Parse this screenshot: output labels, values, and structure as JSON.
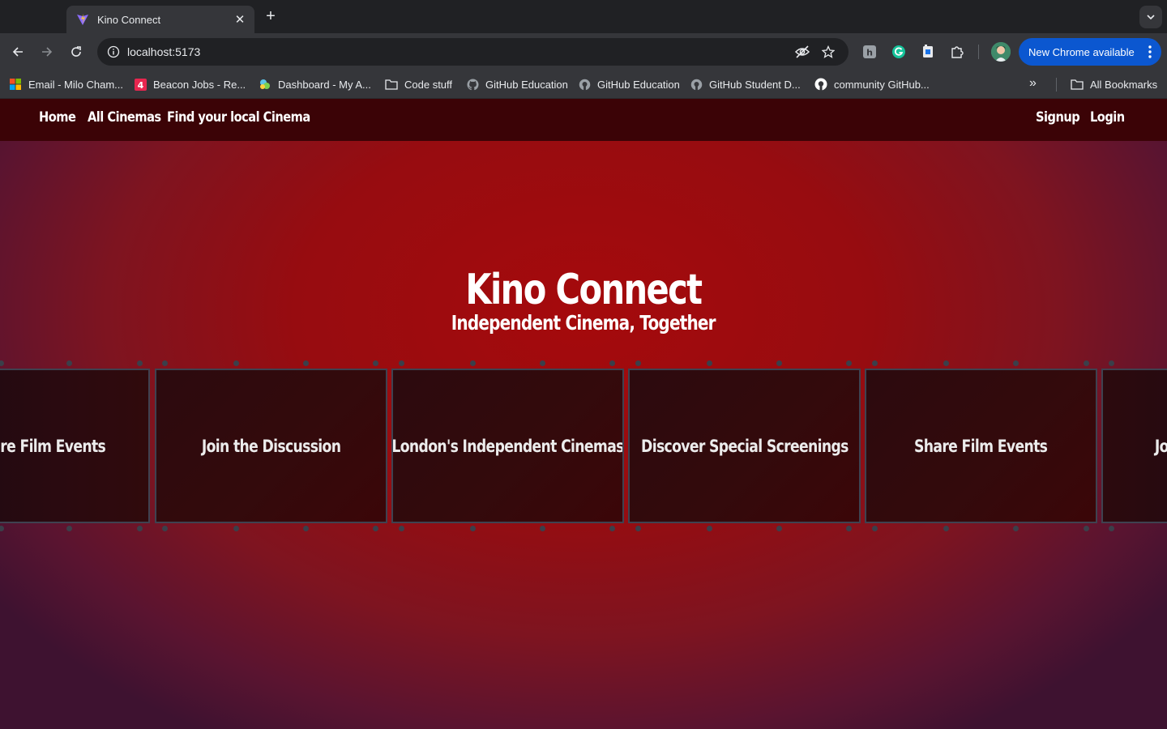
{
  "browser": {
    "tab_title": "Kino Connect",
    "url": "localhost:5173",
    "update_label": "New Chrome available",
    "bookmarks": [
      {
        "label": "Email - Milo Cham...",
        "icon": "microsoft-icon"
      },
      {
        "label": "Beacon Jobs - Re...",
        "icon": "beacon-icon"
      },
      {
        "label": "Dashboard - My A...",
        "icon": "dashboard-icon"
      },
      {
        "label": "Code stuff",
        "icon": "folder-icon"
      },
      {
        "label": "GitHub Education",
        "icon": "github-icon"
      },
      {
        "label": "GitHub Education",
        "icon": "github-icon"
      },
      {
        "label": "GitHub Student D...",
        "icon": "github-icon"
      },
      {
        "label": "community GitHub...",
        "icon": "github-icon"
      }
    ],
    "all_bookmarks_label": "All Bookmarks",
    "accent_color": "#0b57d0"
  },
  "site": {
    "nav_left": [
      "Home",
      "All Cinemas",
      "Find your local Cinema"
    ],
    "nav_right": [
      "Signup",
      "Login"
    ],
    "hero_title": "Kino Connect",
    "hero_subtitle": "Independent Cinema, Together",
    "film_frames": [
      "re Film Events",
      "Join the Discussion",
      "London's Independent Cinemas",
      "Discover Special Screenings",
      "Share Film Events",
      "Jo"
    ],
    "colors": {
      "background": "#970c10",
      "nav": "#3b0306",
      "frame": "#330a0c"
    }
  }
}
